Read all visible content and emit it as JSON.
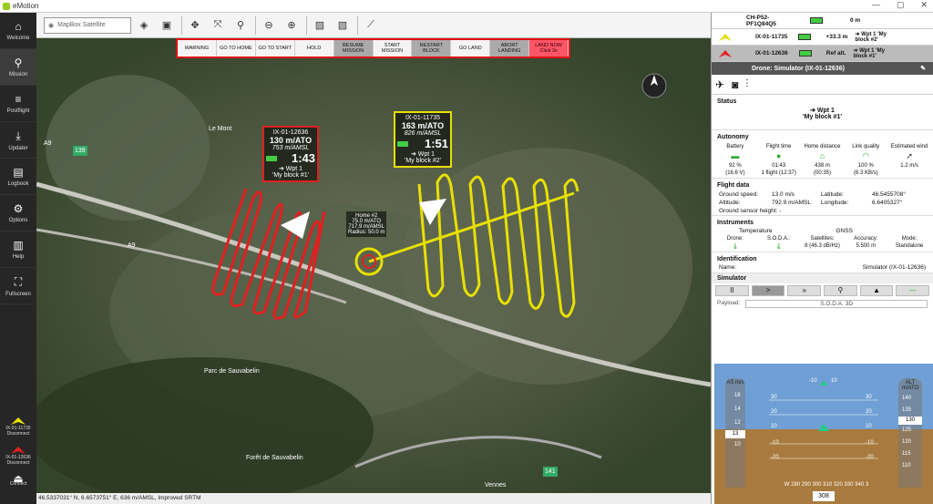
{
  "app": {
    "title": "eMotion"
  },
  "window_controls": {
    "min": "—",
    "max": "▢",
    "close": "✕"
  },
  "sidebar": {
    "items": [
      {
        "label": "Welcome",
        "icon": "home-icon"
      },
      {
        "label": "Mission",
        "icon": "mission-icon"
      },
      {
        "label": "Postflight",
        "icon": "postflight-icon"
      },
      {
        "label": "Updater",
        "icon": "download-icon"
      },
      {
        "label": "Logbook",
        "icon": "logbook-icon"
      },
      {
        "label": "Options",
        "icon": "gear-icon"
      },
      {
        "label": "Help",
        "icon": "book-icon"
      },
      {
        "label": "Fullscreen",
        "icon": "fullscreen-icon"
      }
    ],
    "drones": [
      {
        "id": "IX-01-11735",
        "action": "Disconnect",
        "color": "#e8e000"
      },
      {
        "id": "IX-01-12636",
        "action": "Disconnect",
        "color": "#e02020"
      }
    ],
    "connect_label": "Connect"
  },
  "toolbar": {
    "map_layer": "MapBox Satellite"
  },
  "commands": [
    {
      "label": "WARNING",
      "style": "normal"
    },
    {
      "label": "GO TO HOME",
      "style": "normal"
    },
    {
      "label": "GO TO START",
      "style": "normal"
    },
    {
      "label": "HOLD",
      "style": "normal"
    },
    {
      "label": "RESUME MISSION",
      "style": "grey"
    },
    {
      "label": "START MISSION",
      "style": "normal"
    },
    {
      "label": "RESTART BLOCK",
      "style": "grey"
    },
    {
      "label": "GO LAND",
      "style": "normal"
    },
    {
      "label": "ABORT LANDING",
      "style": "grey"
    },
    {
      "label": "LAND NOW Click 3x",
      "style": "red"
    }
  ],
  "map": {
    "places": [
      "Le Mont",
      "Parc de Sauvabelin",
      "Forêt de Sauvabelin",
      "A9",
      "A9",
      "139",
      "141",
      "Vennes"
    ],
    "drone_red": {
      "id": "IX-01-12636",
      "speed": "130 m/ATO",
      "alt": "753 m/AMSL",
      "time": "1:43",
      "wpt": "➔ Wpt 1",
      "block": "'My block #1'",
      "color": "#e02020"
    },
    "drone_yellow": {
      "id": "IX-01-11735",
      "speed": "163 m/ATO",
      "alt": "826 m/AMSL",
      "time": "1:51",
      "wpt": "➔ Wpt 1",
      "block": "'My block #2'",
      "color": "#e8e000"
    },
    "home": {
      "title": "Home #2",
      "alt1": "75.0 m/ATO",
      "alt2": "717.9 m/AMSL",
      "radius": "Radius: 50.0 m"
    }
  },
  "status_bar": "46.5337031° N, 6.6573751° E, 636 m/AMSL, Improved SRTM",
  "drone_list": [
    {
      "id": "CH-P52-PF1Q84Q5",
      "info": "0 m",
      "target": "",
      "color": "#aaaaaa"
    },
    {
      "id": "IX-01-11735",
      "info": "+33.3 m",
      "target": "➔ Wpt 1 'My block #2'",
      "color": "#e8e000"
    },
    {
      "id": "IX-01-12636",
      "info": "Ref alt.",
      "target": "➔ Wpt 1 'My block #1'",
      "color": "#e02020"
    }
  ],
  "panel": {
    "title": "Drone: Simulator (IX-01-12636)",
    "status_title": "Status",
    "status_wpt": "➔ Wpt 1",
    "status_block": "'My block #1'",
    "autonomy_title": "Autonomy",
    "autonomy_headers": [
      "Battery",
      "Flight time",
      "Home distance",
      "Link quality",
      "Estimated wind"
    ],
    "autonomy_values": [
      "92 %",
      "01:43",
      "438 m",
      "100 %",
      "1.2 m/s"
    ],
    "autonomy_sub": [
      "(16.6 V)",
      "1 flight (12:37)",
      "(00:35)",
      "(6.3 KB/s)",
      ""
    ],
    "flight_title": "Flight data",
    "flight_rows": [
      [
        "Ground speed:",
        "13.0 m/s",
        "Latitude:",
        "46.5455708°"
      ],
      [
        "Altitude:",
        "792.9 m/AMSL",
        "Longitude:",
        "6.6405327°"
      ],
      [
        "Ground sensor height: -",
        "",
        "",
        ""
      ]
    ],
    "instr_title": "Instruments",
    "instr_temp": "Temperature",
    "instr_gnss": "GNSS",
    "instr_cols": [
      "Drone:",
      "S.O.D.A.:",
      "Satellites:",
      "Accuracy:",
      "Mode:"
    ],
    "instr_vals": [
      "",
      "",
      "8 (46.3 dB/Hz)",
      "5.500 m",
      "Standalone"
    ],
    "ident_title": "Identification",
    "ident_name": "Name:",
    "ident_value": "Simulator (IX-01-12636)"
  },
  "simulator": {
    "title": "Simulator",
    "buttons": [
      "II",
      ">",
      "»",
      "⚲",
      "▲",
      "—"
    ],
    "payload_label": "Payload:",
    "payload_value": "S.O.D.A. 3D"
  },
  "pfd": {
    "as_label": "AS m/s",
    "alt_label": "ALT m/ATO",
    "as_ticks": [
      "16",
      "14",
      "12",
      "10"
    ],
    "as_value": "13",
    "alt_ticks": [
      "140",
      "135",
      "125",
      "120",
      "115",
      "110"
    ],
    "alt_value": "130",
    "pitch_labels": [
      "30",
      "20",
      "10",
      "-10",
      "-20",
      "30",
      "20",
      "10",
      "-10",
      "-20"
    ],
    "roll_labels": [
      "-10",
      "10"
    ],
    "heading_scale": "W 280 290 300 310 320 330 340 3",
    "heading_value": "308"
  }
}
